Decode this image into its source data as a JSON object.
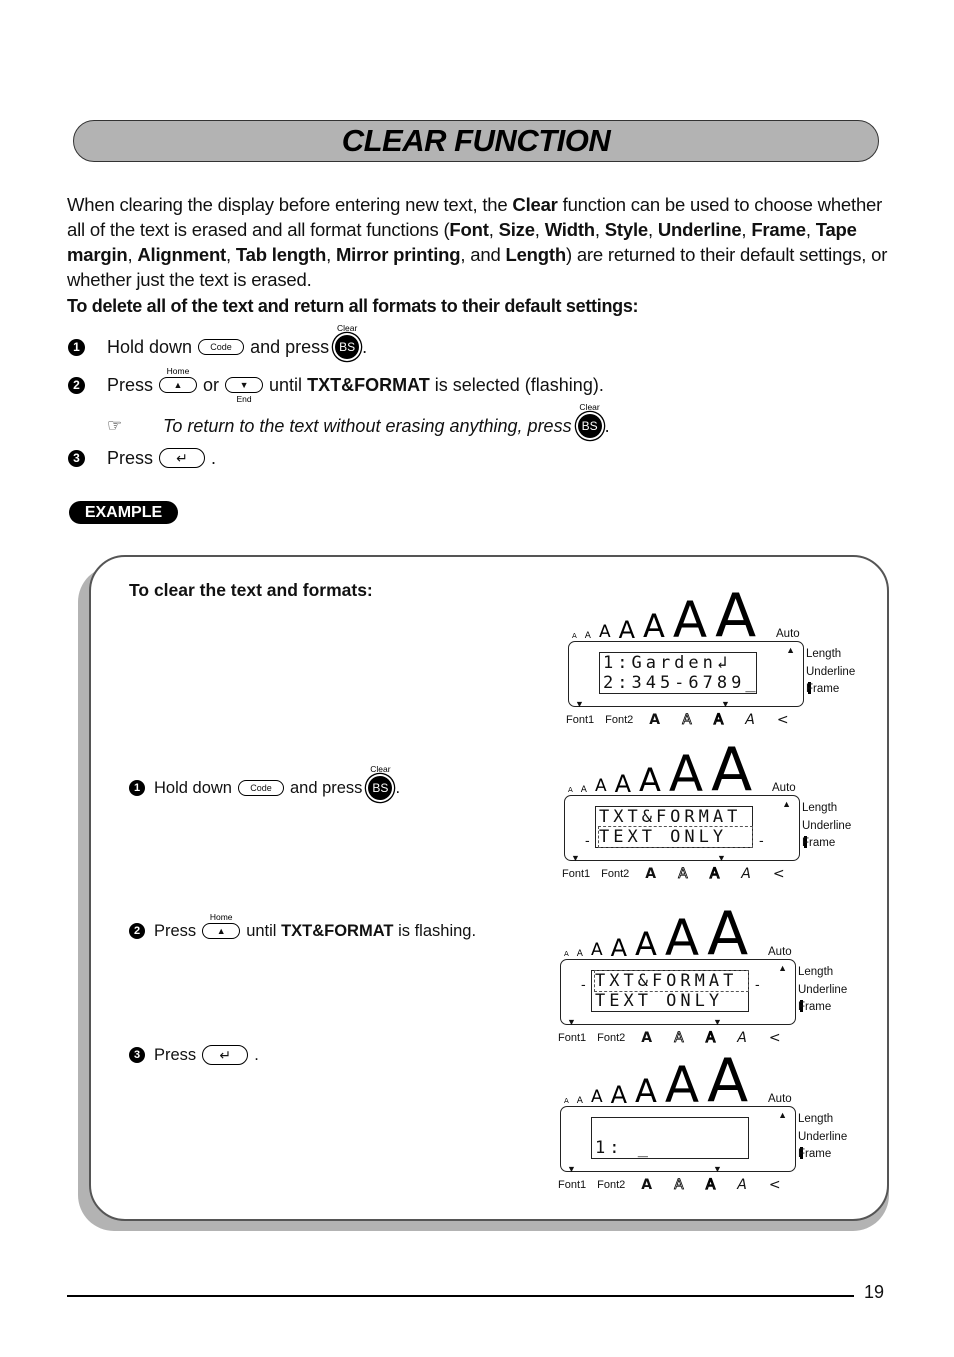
{
  "header": {
    "title": "CLEAR FUNCTION"
  },
  "intro": {
    "parts": [
      {
        "t": "When clearing the display before entering new text, the ",
        "b": false
      },
      {
        "t": "Clear",
        "b": true
      },
      {
        "t": " function can be used to choose whether all of the text is erased and all format functions (",
        "b": false
      },
      {
        "t": "Font",
        "b": true
      },
      {
        "t": ", ",
        "b": false
      },
      {
        "t": "Size",
        "b": true
      },
      {
        "t": ", ",
        "b": false
      },
      {
        "t": "Width",
        "b": true
      },
      {
        "t": ", ",
        "b": false
      },
      {
        "t": "Style",
        "b": true
      },
      {
        "t": ", ",
        "b": false
      },
      {
        "t": "Underline",
        "b": true
      },
      {
        "t": ", ",
        "b": false
      },
      {
        "t": "Frame",
        "b": true
      },
      {
        "t": ", ",
        "b": false
      },
      {
        "t": "Tape margin",
        "b": true
      },
      {
        "t": ", ",
        "b": false
      },
      {
        "t": "Alignment",
        "b": true
      },
      {
        "t": ", ",
        "b": false
      },
      {
        "t": "Tab length",
        "b": true
      },
      {
        "t": ", ",
        "b": false
      },
      {
        "t": "Mirror printing",
        "b": true
      },
      {
        "t": ", and ",
        "b": false
      },
      {
        "t": "Length",
        "b": true
      },
      {
        "t": ") are returned to their default settings, or whether just the text is erased.",
        "b": false
      }
    ]
  },
  "subheading": "To delete all of the text and return all formats to their default settings:",
  "keys": {
    "code": "Code",
    "bs": "BS",
    "clear_caption": "Clear",
    "home_caption": "Home",
    "end_caption": "End",
    "up_arrow": "▲",
    "down_arrow": "▼",
    "enter": "↵"
  },
  "steps": [
    {
      "num": "1",
      "pre": "Hold down",
      "mid": "and press",
      "post": "."
    },
    {
      "num": "2",
      "pre": "Press",
      "mid": "or",
      "post_pre": "until",
      "bold": "TXT&FORMAT",
      "post": "is selected (flashing)."
    },
    {
      "num": "3",
      "pre": "Press",
      "post": "."
    }
  ],
  "note": {
    "icon": "☞",
    "text": "To return to the text without erasing anything, press"
  },
  "example": {
    "badge": "EXAMPLE",
    "title": "To clear the text and formats:",
    "steps": [
      {
        "num": "1",
        "pre": "Hold down",
        "mid": "and press",
        "post": "."
      },
      {
        "num": "2",
        "pre": "Press",
        "post_pre": "until",
        "bold": "TXT&FORMAT",
        "post": "is flashing."
      },
      {
        "num": "3",
        "pre": "Press",
        "post": "."
      }
    ]
  },
  "lcd_common": {
    "sizes": [
      "A",
      "A",
      "A",
      "A",
      "A",
      "A",
      "A"
    ],
    "auto": "Auto",
    "side": [
      "Length",
      "Underline",
      "Frame"
    ],
    "font1": "Font1",
    "font2": "Font2",
    "style_glyphs": [
      "A",
      "A",
      "A",
      "A",
      "<"
    ]
  },
  "lcds": [
    {
      "line1": "1:Garden↲",
      "line2": "2:345-6789_"
    },
    {
      "line1": "TXT&FORMAT",
      "line2": "TEXT ONLY",
      "flashing": "line2"
    },
    {
      "line1": "TXT&FORMAT",
      "line2": "TEXT ONLY",
      "flashing": "line1"
    },
    {
      "line1": "",
      "line2": "1: _"
    }
  ],
  "footer": {
    "page": "19"
  }
}
